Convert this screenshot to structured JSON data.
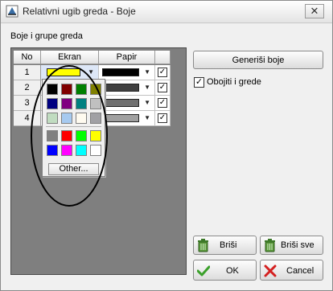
{
  "window": {
    "title": "Relativni ugib greda - Boje",
    "close_symbol": "✕"
  },
  "group_label": "Boje i grupe greda",
  "grid": {
    "headers": {
      "no": "No",
      "ekran": "Ekran",
      "papir": "Papir",
      "check": ""
    },
    "rows": [
      {
        "no": "1",
        "ekran_color": "#ffff00",
        "papir_color": "#000000",
        "checked": "✓"
      },
      {
        "no": "2",
        "ekran_color": "#ffff00",
        "papir_color": "#404040",
        "checked": "✓"
      },
      {
        "no": "3",
        "ekran_color": "#ffff00",
        "papir_color": "#707070",
        "checked": "✓"
      },
      {
        "no": "4",
        "ekran_color": "#ffff00",
        "papir_color": "#a0a0a0",
        "checked": "✓"
      }
    ]
  },
  "palette": {
    "colors": [
      "#000000",
      "#800000",
      "#008000",
      "#808000",
      "#000080",
      "#800080",
      "#008080",
      "#c0c0c0",
      "#c0dcc0",
      "#a6caf0",
      "#fffbf0",
      "#a0a0a4",
      "#808080",
      "#ff0000",
      "#00ff00",
      "#ffff00",
      "#0000ff",
      "#ff00ff",
      "#00ffff",
      "#ffffff"
    ],
    "other_label": "Other..."
  },
  "buttons": {
    "generisi": "Generiši boje",
    "brisi": "Briši",
    "brisi_sve": "Briši sve",
    "ok": "OK",
    "cancel": "Cancel"
  },
  "checkbox": {
    "label": "Obojiti i grede",
    "checked": "✓"
  },
  "icons": {
    "app": "beam-app-icon",
    "close": "close-icon",
    "trash": "trash-icon",
    "ok": "green-check-icon",
    "cancel": "red-x-icon",
    "dropdown": "dropdown-arrow-icon"
  }
}
